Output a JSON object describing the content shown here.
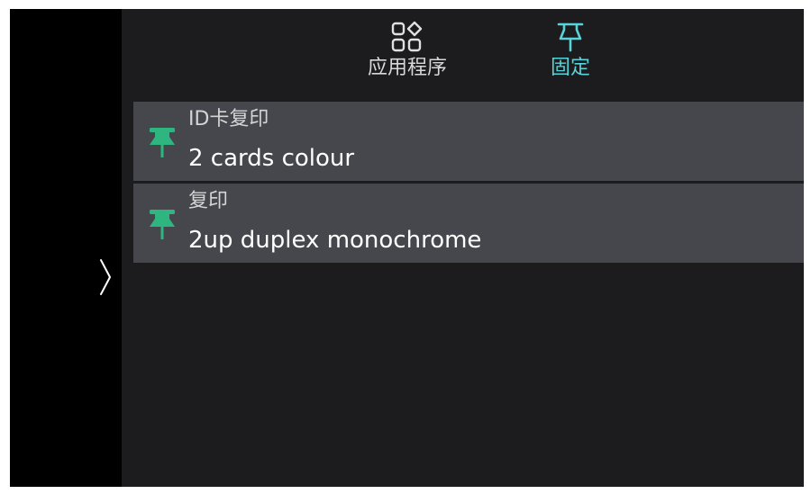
{
  "tabs": [
    {
      "label": "应用程序",
      "icon": "apps-grid-icon",
      "active": false
    },
    {
      "label": "固定",
      "icon": "pin-icon",
      "active": true
    }
  ],
  "pinned_items": [
    {
      "category": "ID卡复印",
      "name": "2 cards colour",
      "icon": "pin-icon"
    },
    {
      "category": "复印",
      "name": "2up duplex monochrome",
      "icon": "pin-icon"
    }
  ],
  "colors": {
    "accent": "#59d2d8",
    "pin_green": "#2fb57f",
    "panel_bg": "#1c1c1f",
    "item_bg": "#45474d",
    "rail_bg": "#000000"
  }
}
